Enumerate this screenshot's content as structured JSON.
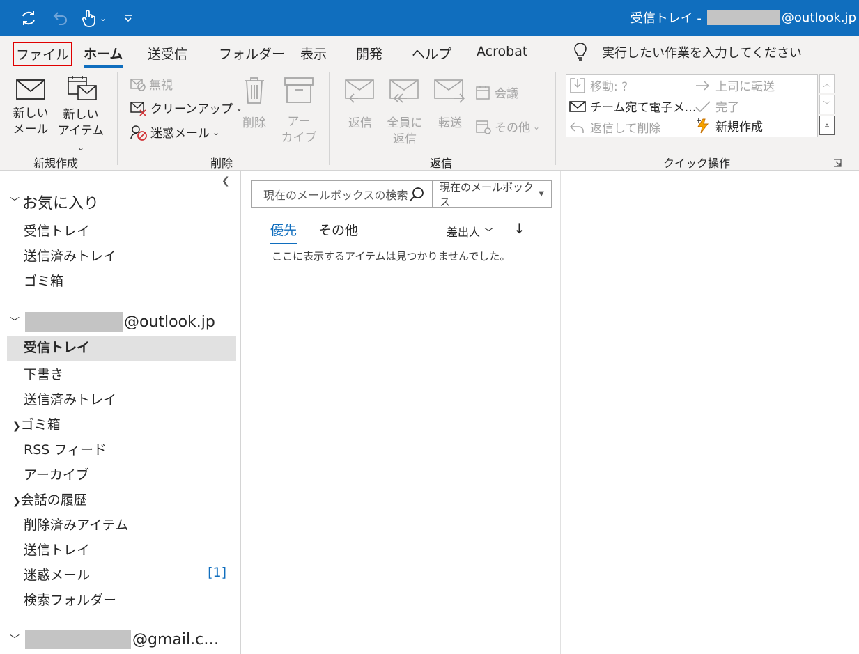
{
  "titlebar": {
    "title_prefix": "受信トレイ -",
    "title_suffix": "@outlook.jp"
  },
  "menu": {
    "tabs": [
      "ファイル",
      "ホーム",
      "送受信",
      "フォルダー",
      "表示",
      "開発",
      "ヘルプ",
      "Acrobat"
    ],
    "tell_me": "実行したい作業を入力してください"
  },
  "ribbon": {
    "new": {
      "new_mail": [
        "新しい",
        "メール"
      ],
      "new_item": [
        "新しい",
        "アイテム"
      ],
      "label": "新規作成"
    },
    "delete": {
      "ignore": "無視",
      "cleanup": "クリーンアップ",
      "junk": "迷惑メール",
      "delete": "削除",
      "archive": [
        "アー",
        "カイブ"
      ],
      "label": "削除"
    },
    "respond": {
      "reply": "返信",
      "reply_all": [
        "全員に",
        "返信"
      ],
      "forward": "転送",
      "meeting": "会議",
      "more": "その他",
      "label": "返信"
    },
    "quick_steps": {
      "move": "移動: ?",
      "to_manager": "上司に転送",
      "team_email": "チーム宛て電子メ…",
      "done": "完了",
      "reply_delete": "返信して削除",
      "create_new": "新規作成",
      "label": "クイック操作"
    }
  },
  "folders": {
    "favorites_header": "お気に入り",
    "favorites": [
      "受信トレイ",
      "送信済みトレイ",
      "ゴミ箱"
    ],
    "account1_suffix": "@outlook.jp",
    "account1_items": [
      "受信トレイ",
      "下書き",
      "送信済みトレイ",
      "ゴミ箱",
      "RSS フィード",
      "アーカイブ",
      "会話の履歴",
      "削除済みアイテム",
      "送信トレイ",
      "迷惑メール",
      "検索フォルダー"
    ],
    "junk_badge": "[1]",
    "account2_suffix": "@gmail.c…"
  },
  "list": {
    "search_placeholder": "現在のメールボックスの検索",
    "scope": "現在のメールボックス",
    "tab_focused": "優先",
    "tab_other": "その他",
    "sort_by": "差出人",
    "sort_dir": "↓",
    "empty": "ここに表示するアイテムは見つかりませんでした。"
  },
  "colors": {
    "titlebar": "#106ebe",
    "accent": "#106ebe",
    "highlight": "#e00000"
  }
}
